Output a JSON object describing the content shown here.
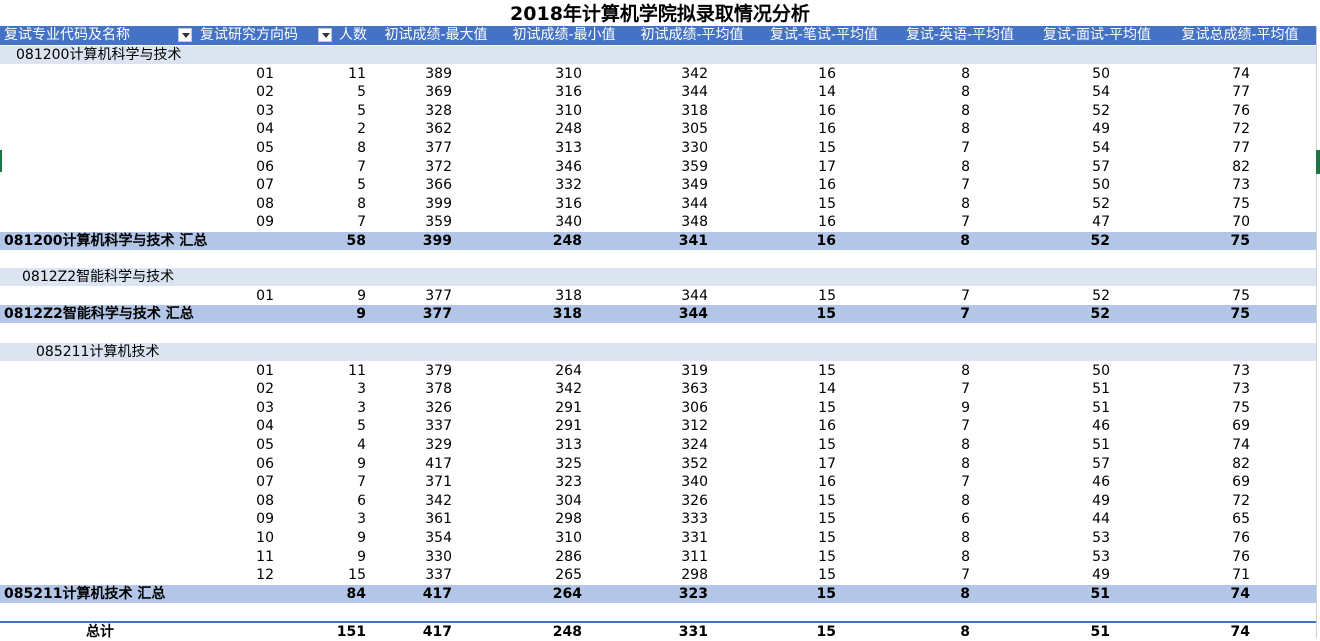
{
  "title": "2018年计算机学院拟录取情况分析",
  "header": {
    "col0": "复试专业代码及名称",
    "col1": "复试研究方向码",
    "col2": "人数",
    "col3": "初试成绩-最大值",
    "col4": "初试成绩-最小值",
    "col5": "初试成绩-平均值",
    "col6": "复试-笔试-平均值",
    "col7": "复试-英语-平均值",
    "col8": "复试-面试-平均值",
    "col9": "复试总成绩-平均值"
  },
  "groups": [
    {
      "name": "081200计算机科学与技术",
      "rows": [
        [
          "01",
          "11",
          "389",
          "310",
          "342",
          "16",
          "8",
          "50",
          "74"
        ],
        [
          "02",
          "5",
          "369",
          "316",
          "344",
          "14",
          "8",
          "54",
          "77"
        ],
        [
          "03",
          "5",
          "328",
          "310",
          "318",
          "16",
          "8",
          "52",
          "76"
        ],
        [
          "04",
          "2",
          "362",
          "248",
          "305",
          "16",
          "8",
          "49",
          "72"
        ],
        [
          "05",
          "8",
          "377",
          "313",
          "330",
          "15",
          "7",
          "54",
          "77"
        ],
        [
          "06",
          "7",
          "372",
          "346",
          "359",
          "17",
          "8",
          "57",
          "82"
        ],
        [
          "07",
          "5",
          "366",
          "332",
          "349",
          "16",
          "7",
          "50",
          "73"
        ],
        [
          "08",
          "8",
          "399",
          "316",
          "344",
          "15",
          "8",
          "52",
          "75"
        ],
        [
          "09",
          "7",
          "359",
          "340",
          "348",
          "16",
          "7",
          "47",
          "70"
        ]
      ],
      "subtotal": [
        "081200计算机科学与技术 汇总",
        "58",
        "399",
        "248",
        "341",
        "16",
        "8",
        "52",
        "75"
      ]
    },
    {
      "name": "0812Z2智能科学与技术",
      "rows": [
        [
          "01",
          "9",
          "377",
          "318",
          "344",
          "15",
          "7",
          "52",
          "75"
        ]
      ],
      "subtotal": [
        "0812Z2智能科学与技术 汇总",
        "9",
        "377",
        "318",
        "344",
        "15",
        "7",
        "52",
        "75"
      ]
    },
    {
      "name": "085211计算机技术",
      "rows": [
        [
          "01",
          "11",
          "379",
          "264",
          "319",
          "15",
          "8",
          "50",
          "73"
        ],
        [
          "02",
          "3",
          "378",
          "342",
          "363",
          "14",
          "7",
          "51",
          "73"
        ],
        [
          "03",
          "3",
          "326",
          "291",
          "306",
          "15",
          "9",
          "51",
          "75"
        ],
        [
          "04",
          "5",
          "337",
          "291",
          "312",
          "16",
          "7",
          "46",
          "69"
        ],
        [
          "05",
          "4",
          "329",
          "313",
          "324",
          "15",
          "8",
          "51",
          "74"
        ],
        [
          "06",
          "9",
          "417",
          "325",
          "352",
          "17",
          "8",
          "57",
          "82"
        ],
        [
          "07",
          "7",
          "371",
          "323",
          "340",
          "16",
          "7",
          "46",
          "69"
        ],
        [
          "08",
          "6",
          "342",
          "304",
          "326",
          "15",
          "8",
          "49",
          "72"
        ],
        [
          "09",
          "3",
          "361",
          "298",
          "333",
          "15",
          "6",
          "44",
          "65"
        ],
        [
          "10",
          "9",
          "354",
          "310",
          "331",
          "15",
          "8",
          "53",
          "76"
        ],
        [
          "11",
          "9",
          "330",
          "286",
          "311",
          "15",
          "8",
          "53",
          "76"
        ],
        [
          "12",
          "15",
          "337",
          "265",
          "298",
          "15",
          "7",
          "49",
          "71"
        ]
      ],
      "subtotal": [
        "085211计算机技术 汇总",
        "84",
        "417",
        "264",
        "323",
        "15",
        "8",
        "51",
        "74"
      ]
    }
  ],
  "total": [
    "总计",
    "151",
    "417",
    "248",
    "331",
    "15",
    "8",
    "51",
    "74"
  ]
}
